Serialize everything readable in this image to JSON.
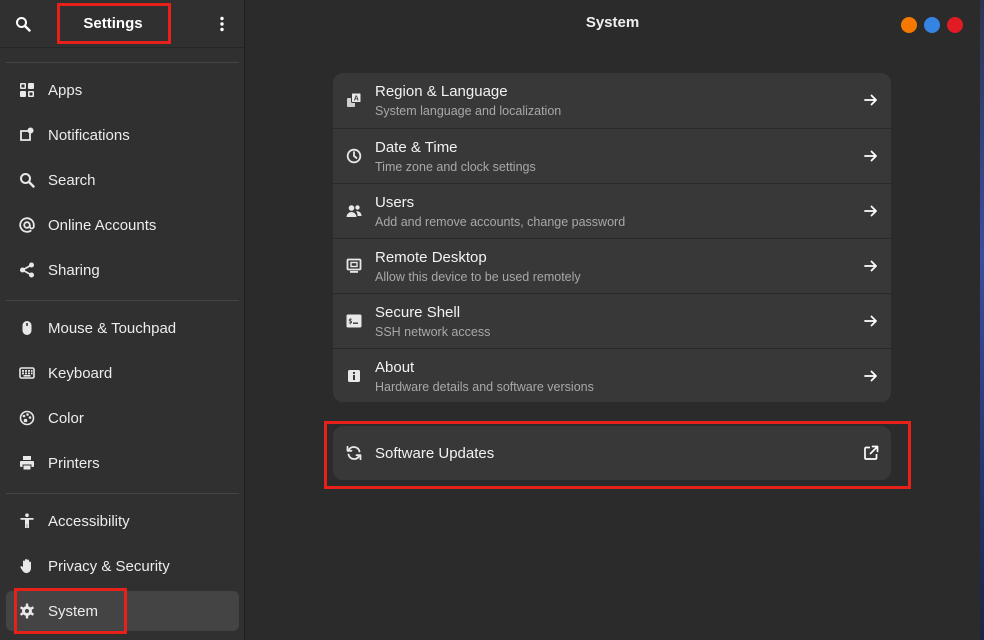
{
  "sidebar": {
    "title": "Settings",
    "items": [
      {
        "label": "Apps"
      },
      {
        "label": "Notifications"
      },
      {
        "label": "Search"
      },
      {
        "label": "Online Accounts"
      },
      {
        "label": "Sharing"
      },
      {
        "label": "Mouse & Touchpad"
      },
      {
        "label": "Keyboard"
      },
      {
        "label": "Color"
      },
      {
        "label": "Printers"
      },
      {
        "label": "Accessibility"
      },
      {
        "label": "Privacy & Security"
      },
      {
        "label": "System"
      }
    ],
    "selected": "System"
  },
  "main": {
    "title": "System",
    "rows": [
      {
        "title": "Region & Language",
        "subtitle": "System language and localization"
      },
      {
        "title": "Date & Time",
        "subtitle": "Time zone and clock settings"
      },
      {
        "title": "Users",
        "subtitle": "Add and remove accounts, change password"
      },
      {
        "title": "Remote Desktop",
        "subtitle": "Allow this device to be used remotely"
      },
      {
        "title": "Secure Shell",
        "subtitle": "SSH network access"
      },
      {
        "title": "About",
        "subtitle": "Hardware details and software versions"
      }
    ],
    "updates": {
      "label": "Software Updates"
    }
  },
  "colors": {
    "window_minimize": "#f57900",
    "window_maximize": "#3584e4",
    "window_close": "#e01b24",
    "highlight": "#e8201a"
  }
}
